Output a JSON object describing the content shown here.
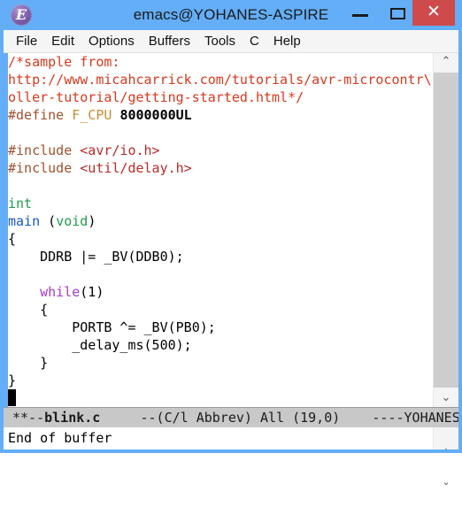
{
  "window": {
    "title": "emacs@YOHANES-ASPIRE",
    "app_icon": "emacs-icon",
    "icon_glyph": "E",
    "controls": {
      "minimize_label": "—",
      "maximize_label": "❐",
      "close_label": "✕"
    },
    "colors": {
      "titlebar": "#63aef7",
      "close_button": "#cf4b4b",
      "menubar": "#f5f5f5",
      "modeline": "#c8c8c8",
      "buffer_bg": "#ffffff"
    }
  },
  "menubar": {
    "items": [
      {
        "label": "File"
      },
      {
        "label": "Edit"
      },
      {
        "label": "Options"
      },
      {
        "label": "Buffers"
      },
      {
        "label": "Tools"
      },
      {
        "label": "C"
      },
      {
        "label": "Help"
      }
    ]
  },
  "buffer": {
    "lines": [
      {
        "segments": [
          {
            "text": "/*sample from:",
            "face": "c-comment"
          }
        ]
      },
      {
        "segments": [
          {
            "text": "http://www.micahcarrick.com/tutorials/avr-microcontr\\",
            "face": "c-comment"
          }
        ]
      },
      {
        "segments": [
          {
            "text": "oller-tutorial/getting-started.html*/",
            "face": "c-comment"
          }
        ]
      },
      {
        "segments": [
          {
            "text": "#define",
            "face": "c-preproc"
          },
          {
            "text": " ",
            "face": "c-plain"
          },
          {
            "text": "F_CPU",
            "face": "c-macro"
          },
          {
            "text": " ",
            "face": "c-plain"
          },
          {
            "text": "8000000UL",
            "face": "c-const"
          }
        ]
      },
      {
        "segments": [
          {
            "text": "",
            "face": "c-plain"
          }
        ]
      },
      {
        "segments": [
          {
            "text": "#include",
            "face": "c-preproc"
          },
          {
            "text": " ",
            "face": "c-plain"
          },
          {
            "text": "<avr/io.h>",
            "face": "c-string"
          }
        ]
      },
      {
        "segments": [
          {
            "text": "#include",
            "face": "c-preproc"
          },
          {
            "text": " ",
            "face": "c-plain"
          },
          {
            "text": "<util/delay.h>",
            "face": "c-string"
          }
        ]
      },
      {
        "segments": [
          {
            "text": "",
            "face": "c-plain"
          }
        ]
      },
      {
        "segments": [
          {
            "text": "int",
            "face": "c-type"
          }
        ]
      },
      {
        "segments": [
          {
            "text": "main",
            "face": "c-func"
          },
          {
            "text": " (",
            "face": "c-plain"
          },
          {
            "text": "void",
            "face": "c-type"
          },
          {
            "text": ")",
            "face": "c-plain"
          }
        ]
      },
      {
        "segments": [
          {
            "text": "{",
            "face": "c-plain"
          }
        ]
      },
      {
        "segments": [
          {
            "text": "    DDRB |= _BV(DDB0);",
            "face": "c-plain"
          }
        ]
      },
      {
        "segments": [
          {
            "text": "",
            "face": "c-plain"
          }
        ]
      },
      {
        "segments": [
          {
            "text": "    ",
            "face": "c-plain"
          },
          {
            "text": "while",
            "face": "c-kw"
          },
          {
            "text": "(1)",
            "face": "c-plain"
          }
        ]
      },
      {
        "segments": [
          {
            "text": "    {",
            "face": "c-plain"
          }
        ]
      },
      {
        "segments": [
          {
            "text": "        PORTB ^= _BV(PB0);",
            "face": "c-plain"
          }
        ]
      },
      {
        "segments": [
          {
            "text": "        _delay_ms(500);",
            "face": "c-plain"
          }
        ]
      },
      {
        "segments": [
          {
            "text": "    }",
            "face": "c-plain"
          }
        ]
      },
      {
        "segments": [
          {
            "text": "}",
            "face": "c-plain"
          }
        ]
      }
    ],
    "cursor": {
      "line": 19,
      "column": 0
    }
  },
  "scrollbar": {
    "up_arrow": "⌃",
    "down_arrow": "⌄"
  },
  "modeline": {
    "modified_flags": "**--",
    "buffer_name": "blink.c",
    "rest": "     --(C/l Abbrev) All (19,0)    ----YOHANES"
  },
  "minibuffer": {
    "message": "End of buffer",
    "scroll_up": "⌃",
    "scroll_down": "⌄"
  }
}
